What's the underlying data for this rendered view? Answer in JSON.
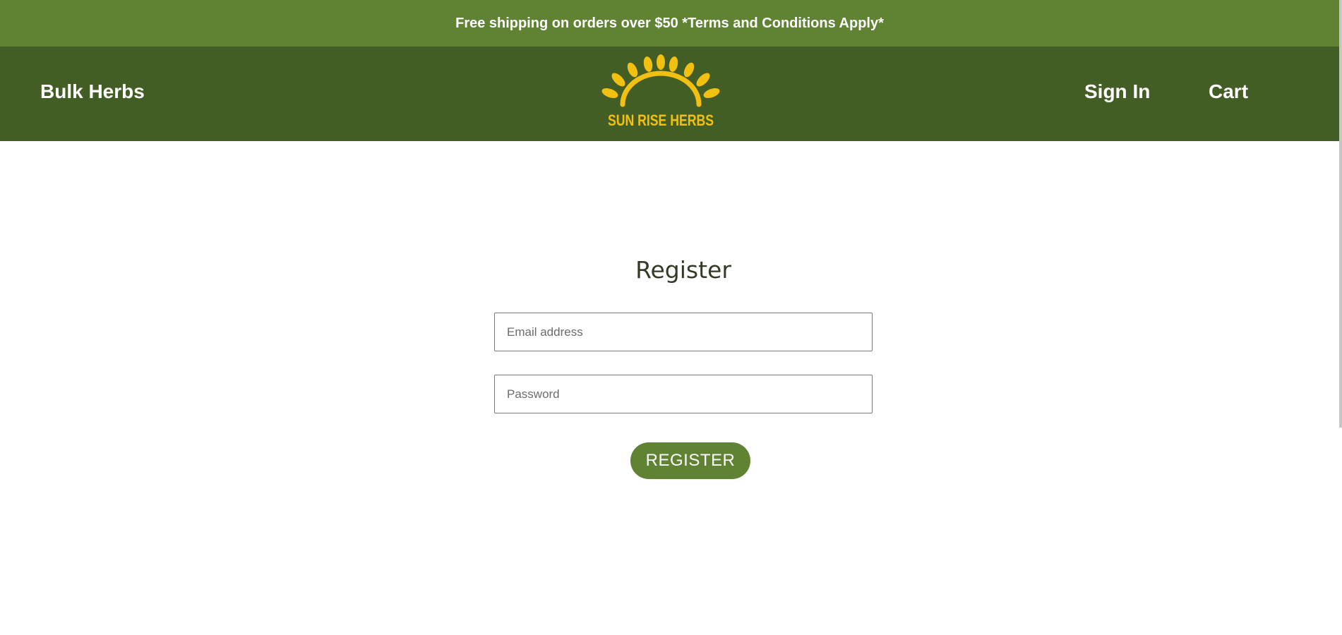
{
  "announcement": {
    "text": "Free shipping on orders over $50 *Terms and Conditions Apply*"
  },
  "nav": {
    "left_link": "Bulk Herbs",
    "sign_in": "Sign In",
    "cart": "Cart"
  },
  "logo": {
    "brand_text": "SUN RISE HERBS",
    "icon": "sunrise-leaves-icon"
  },
  "form": {
    "title": "Register",
    "email_placeholder": "Email address",
    "email_value": "",
    "password_placeholder": "Password",
    "password_value": "",
    "submit_label": "REGISTER"
  },
  "colors": {
    "announcement_bg": "#5f8233",
    "navbar_bg": "#435e24",
    "logo_yellow": "#f2c010",
    "button_bg": "#5f8233"
  }
}
